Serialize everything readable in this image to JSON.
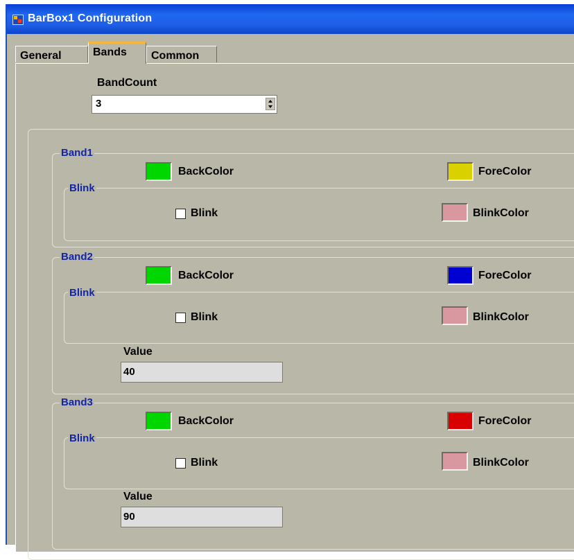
{
  "window": {
    "title": "BarBox1 Configuration"
  },
  "tabs": [
    {
      "label": "General",
      "active": false
    },
    {
      "label": "Bands",
      "active": true
    },
    {
      "label": "Common",
      "active": false
    }
  ],
  "band_count": {
    "label": "BandCount",
    "value": "3"
  },
  "bands": [
    {
      "name": "Band1",
      "back_color_label": "BackColor",
      "back_color": "#00d600",
      "fore_color_label": "ForeColor",
      "fore_color": "#d9d200",
      "blink_group": "Blink",
      "blink_label": "Blink",
      "blink_checked": false,
      "blink_color_label": "BlinkColor",
      "blink_color": "#d9979f"
    },
    {
      "name": "Band2",
      "back_color_label": "BackColor",
      "back_color": "#00d600",
      "fore_color_label": "ForeColor",
      "fore_color": "#0000d2",
      "blink_group": "Blink",
      "blink_label": "Blink",
      "blink_checked": false,
      "blink_color_label": "BlinkColor",
      "blink_color": "#d9979f",
      "value_label": "Value",
      "value": "40"
    },
    {
      "name": "Band3",
      "back_color_label": "BackColor",
      "back_color": "#00d600",
      "fore_color_label": "ForeColor",
      "fore_color": "#d80000",
      "blink_group": "Blink",
      "blink_label": "Blink",
      "blink_checked": false,
      "blink_color_label": "BlinkColor",
      "blink_color": "#d9979f",
      "value_label": "Value",
      "value": "90"
    }
  ]
}
